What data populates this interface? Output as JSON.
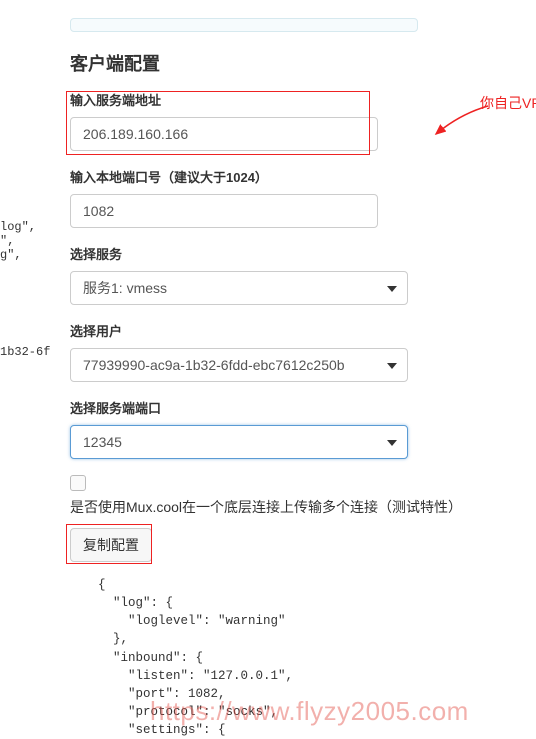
{
  "left_fragments": {
    "top": "log\",\n\",\ng\",",
    "mid": "1b32-6f"
  },
  "title": "客户端配置",
  "annotation": "你自己VPS的IP",
  "fields": {
    "server_addr": {
      "label": "输入服务端地址",
      "value": "206.189.160.166"
    },
    "local_port": {
      "label": "输入本地端口号（建议大于1024）",
      "value": "1082"
    },
    "service": {
      "label": "选择服务",
      "value": "服务1: vmess"
    },
    "user": {
      "label": "选择用户",
      "value": "77939990-ac9a-1b32-6fdd-ebc7612c250b"
    },
    "server_port": {
      "label": "选择服务端端口",
      "value": "12345"
    }
  },
  "mux": {
    "label": "是否使用Mux.cool在一个底层连接上传输多个连接（测试特性）",
    "checked": false
  },
  "copy_btn": "复制配置",
  "config_json": "{\n  \"log\": {\n    \"loglevel\": \"warning\"\n  },\n  \"inbound\": {\n    \"listen\": \"127.0.0.1\",\n    \"port\": 1082,\n    \"protocol\": \"socks\",\n    \"settings\": {",
  "watermark": "https://www.flyzy2005.com"
}
